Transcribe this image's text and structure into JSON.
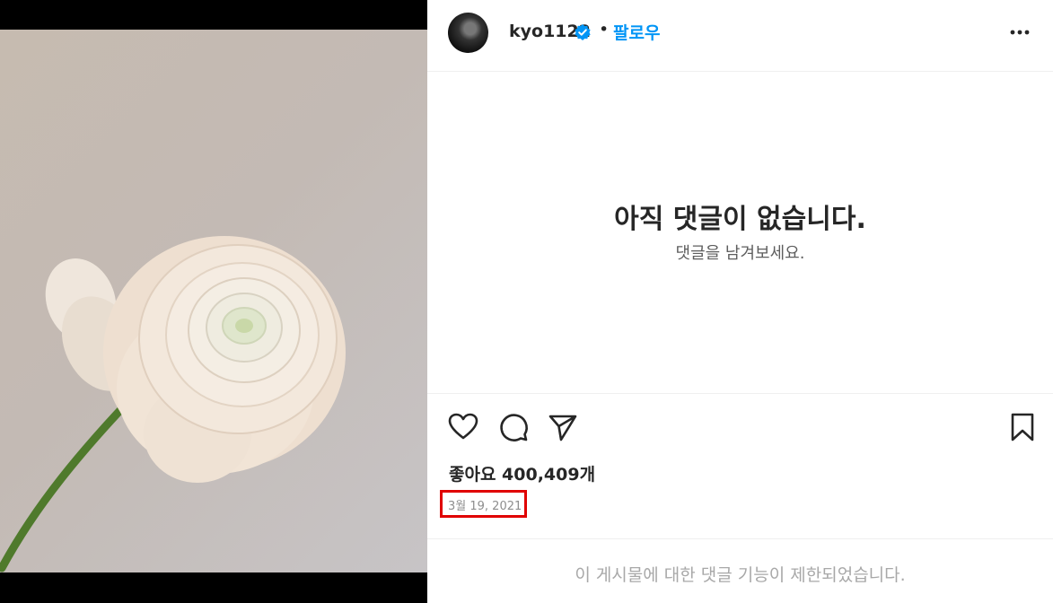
{
  "post": {
    "username": "kyo1122",
    "dot": "•",
    "follow_label": "팔로우",
    "empty_title": "아직 댓글이 없습니다.",
    "empty_subtitle": "댓글을 남겨보세요.",
    "likes_text": "좋아요 400,409개",
    "date": "3월 19, 2021",
    "restricted_text": "이 게시물에 대한 댓글 기능이 제한되었습니다."
  },
  "icons": {
    "verified": "verified-badge-icon",
    "more": "more-options-icon",
    "like": "heart-icon",
    "comment": "comment-icon",
    "share": "share-icon",
    "save": "bookmark-icon"
  },
  "colors": {
    "follow": "#0095f6",
    "verified": "#0095f6",
    "highlight_box": "#e00000"
  }
}
